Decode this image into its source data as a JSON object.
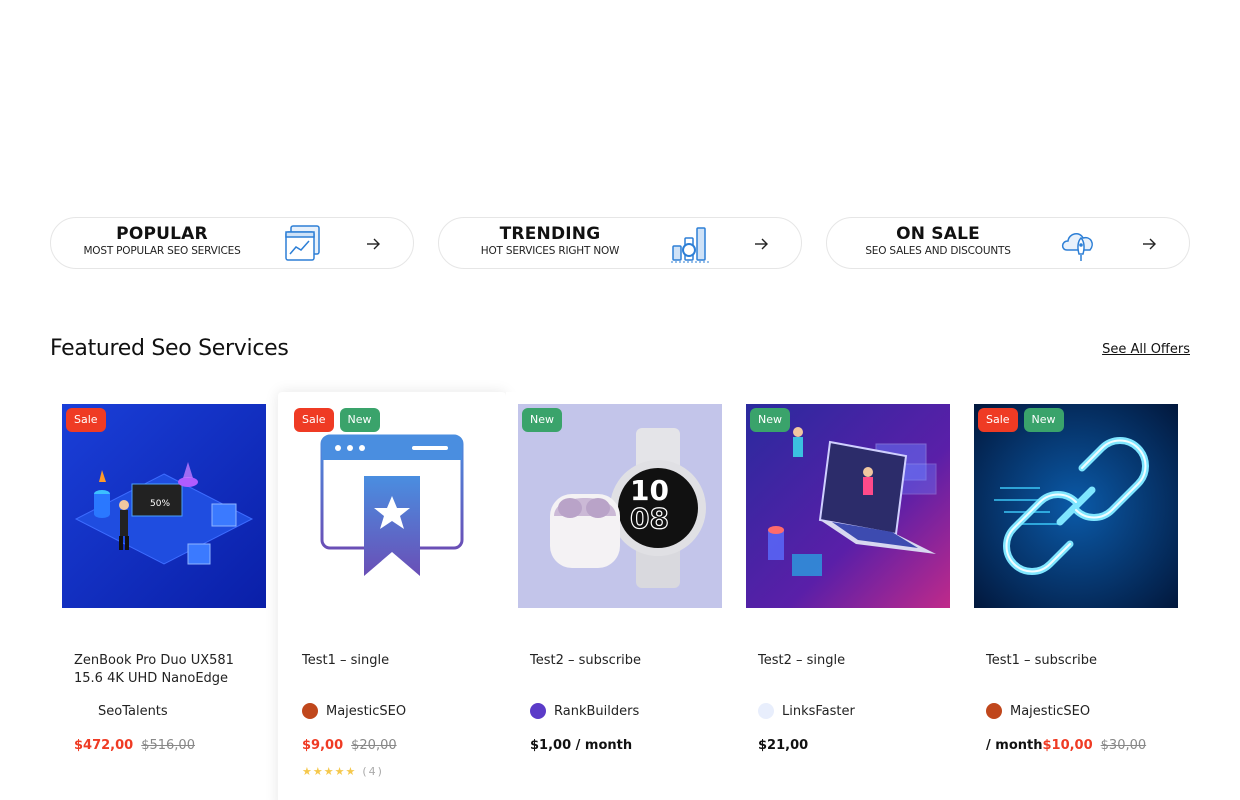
{
  "categories": [
    {
      "title": "POPULAR",
      "subtitle": "MOST POPULAR SEO SERVICES",
      "icon": "chart-window-icon"
    },
    {
      "title": "TRENDING",
      "subtitle": "HOT SERVICES RIGHT NOW",
      "icon": "bar-search-icon"
    },
    {
      "title": "ON SALE",
      "subtitle": "SEO SALES AND DISCOUNTS",
      "icon": "cloud-rocket-icon"
    }
  ],
  "section": {
    "title": "Featured Seo Services",
    "see_all": "See All Offers"
  },
  "products": [
    {
      "name": "ZenBook Pro Duo UX581 15.6 4K UHD NanoEdge",
      "vendor": "SeoTalents",
      "price": "$472,00",
      "old_price": "$516,00",
      "badges": [
        "Sale"
      ]
    },
    {
      "name": "Test1 – single",
      "vendor": "MajesticSEO",
      "price": "$9,00",
      "old_price": "$20,00",
      "badges": [
        "Sale",
        "New"
      ],
      "rating_count": "(4)",
      "stars": "★★★★★"
    },
    {
      "name": "Test2 – subscribe",
      "vendor": "RankBuilders",
      "price": "$1,00 / month",
      "badges": [
        "New"
      ]
    },
    {
      "name": "Test2 – single",
      "vendor": "LinksFaster",
      "price": "$21,00",
      "badges": [
        "New"
      ]
    },
    {
      "name": "Test1 – subscribe",
      "vendor": "MajesticSEO",
      "price_prefix": "/ month",
      "price": "$10,00",
      "old_price": "$30,00",
      "badges": [
        "Sale",
        "New"
      ]
    }
  ],
  "colors": {
    "sale": "#ef3b24",
    "new": "#3aa36b",
    "icon_blue": "#2d7fd6"
  }
}
